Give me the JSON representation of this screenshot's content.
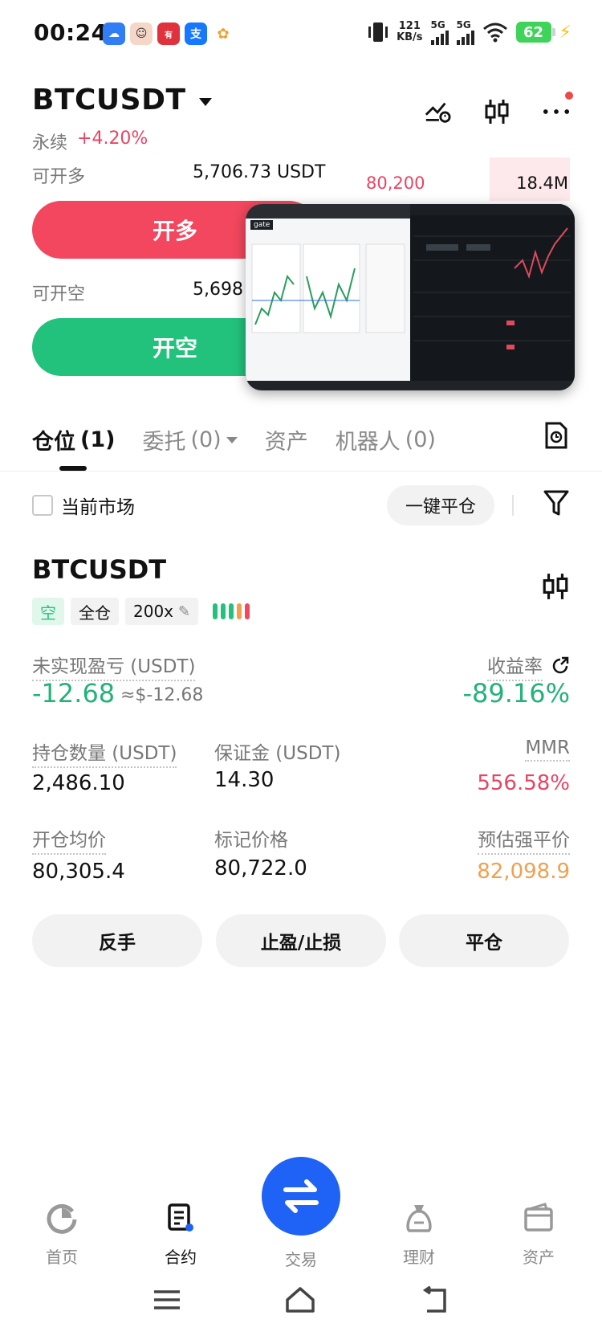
{
  "status_bar": {
    "time": "00:24",
    "net_speed_value": "121",
    "net_speed_unit": "KB/s",
    "sim1": "5G",
    "sim2": "5G",
    "battery": "62",
    "app_icons": [
      "baidu-netdisk",
      "avatar-app",
      "youdao",
      "alipay",
      "photos"
    ]
  },
  "header": {
    "pair": "BTCUSDT",
    "contract_type": "永续",
    "change": "+4.20%"
  },
  "trade_panel": {
    "long_available_label": "可开多",
    "long_available_value": "5,706.73 USDT",
    "open_long_label": "开多",
    "short_available_label": "可开空",
    "short_available_value": "5,698",
    "open_short_label": "开空",
    "orderbook_price": "80,200",
    "orderbook_qty": "18.4M"
  },
  "pip": {
    "brand": "gate"
  },
  "tabs": [
    {
      "label": "仓位",
      "count": "(1)"
    },
    {
      "label": "委托",
      "count": "(0)"
    },
    {
      "label": "资产",
      "count": ""
    },
    {
      "label": "机器人",
      "count": "(0)"
    }
  ],
  "filters": {
    "current_market": "当前市场",
    "close_all": "一键平仓"
  },
  "position": {
    "symbol": "BTCUSDT",
    "side_tag": "空",
    "margin_mode": "全仓",
    "leverage": "200x",
    "unrealized_pnl_label": "未实现盈亏 (USDT)",
    "unrealized_pnl": "-12.68",
    "unrealized_pnl_usd": "≈$-12.68",
    "roi_label": "收益率",
    "roi": "-89.16%",
    "size_label": "持仓数量 (USDT)",
    "size": "2,486.10",
    "margin_label": "保证金 (USDT)",
    "margin": "14.30",
    "mmr_label": "MMR",
    "mmr": "556.58%",
    "entry_label": "开仓均价",
    "entry": "80,305.4",
    "mark_label": "标记价格",
    "mark": "80,722.0",
    "liq_label": "预估强平价",
    "liq": "82,098.9",
    "liq_color": "#f0a050",
    "actions": {
      "reverse": "反手",
      "tpsl": "止盈/止损",
      "close": "平仓"
    }
  },
  "bottom_nav": {
    "home": "首页",
    "futures": "合约",
    "trade": "交易",
    "earn": "理财",
    "assets": "资产"
  },
  "colors": {
    "long": "#f2475e",
    "short": "#23c27c",
    "accent": "#1e63f5"
  }
}
